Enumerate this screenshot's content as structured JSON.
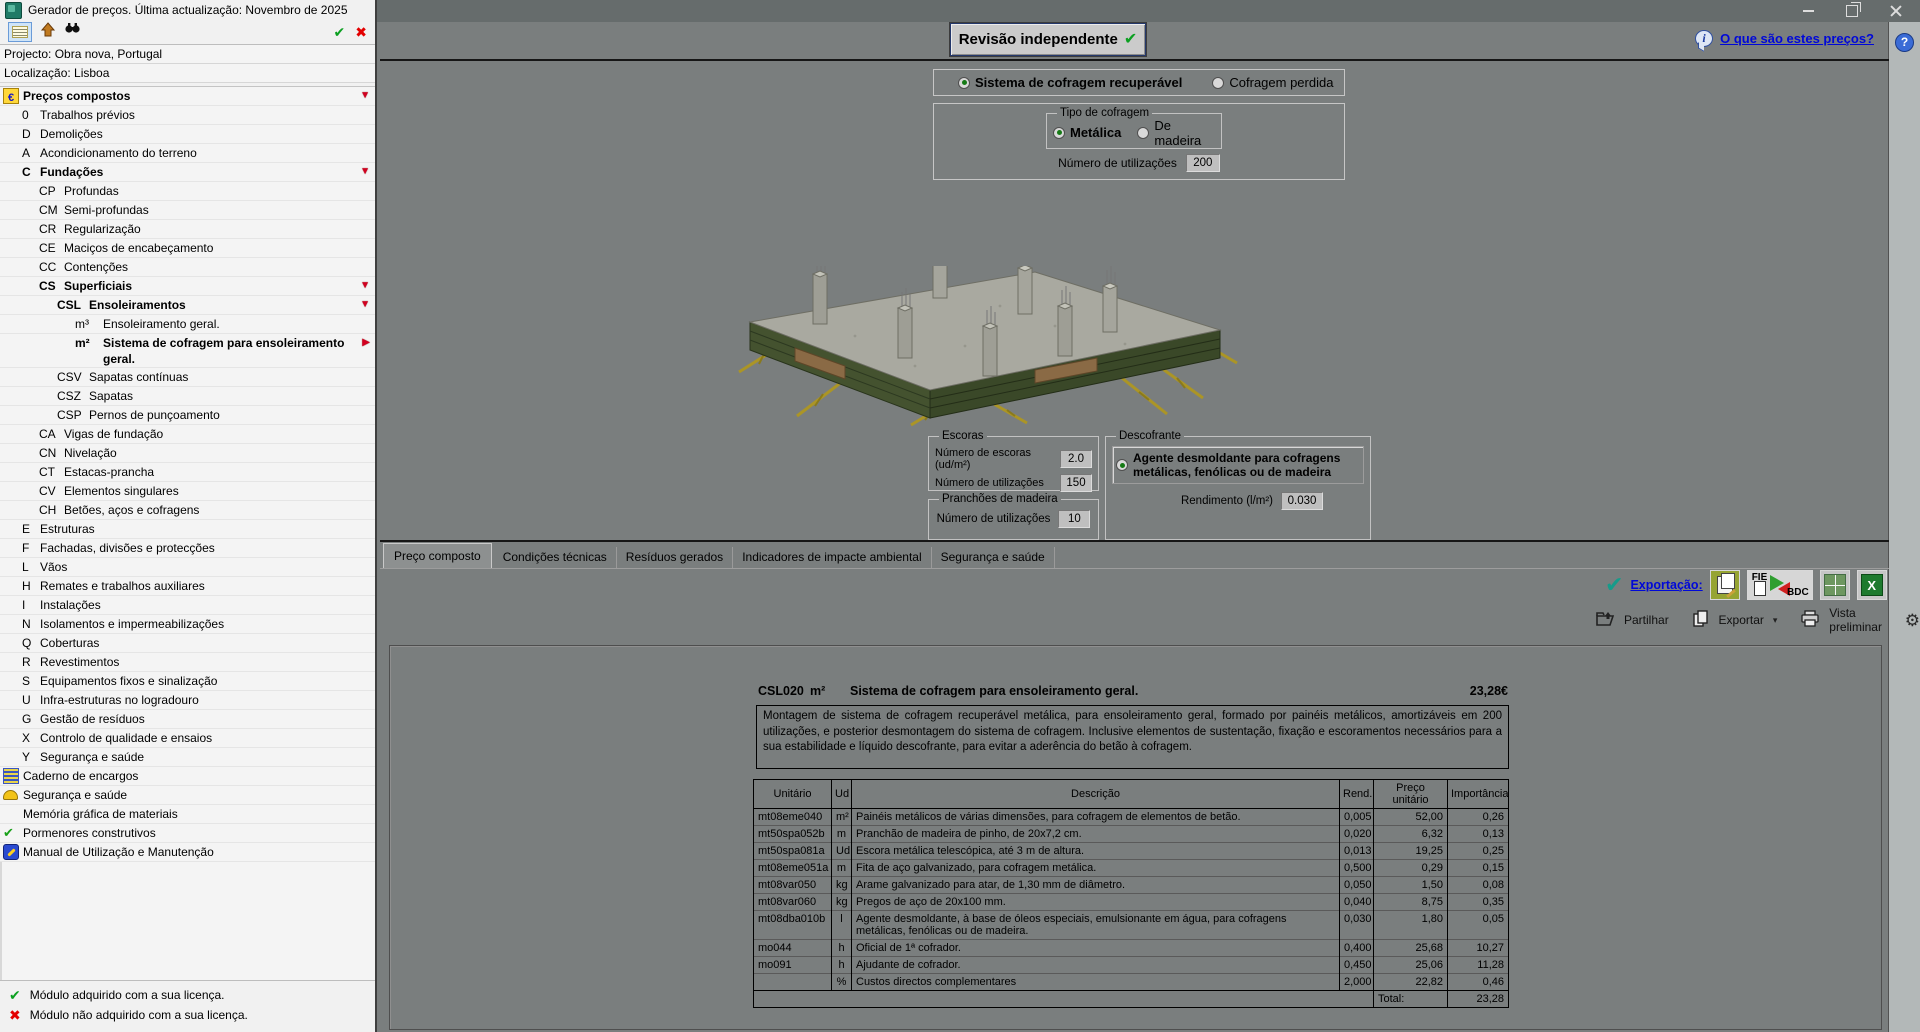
{
  "icons": {
    "check": "✔",
    "cross": "✖",
    "gear": "⚙",
    "dropdown": "▾",
    "info_i": "i",
    "help_q": "?"
  },
  "titlebar": {
    "title": "Gerador de preços. Última actualização: Novembro de 2025"
  },
  "left_panel": {
    "project": "Projecto: Obra nova, Portugal",
    "location": "Localização: Lisboa",
    "tree": [
      {
        "indent": 0,
        "icon": "euro",
        "code": "",
        "label": "Preços compostos",
        "bold": true,
        "marker": "▼"
      },
      {
        "indent": 1,
        "code": "0",
        "label": "Trabalhos prévios"
      },
      {
        "indent": 1,
        "code": "D",
        "label": "Demolições"
      },
      {
        "indent": 1,
        "code": "A",
        "label": "Acondicionamento do terreno"
      },
      {
        "indent": 1,
        "code": "C",
        "label": "Fundações",
        "bold": true,
        "marker": "▼"
      },
      {
        "indent": 2,
        "code": "CP",
        "label": "Profundas"
      },
      {
        "indent": 2,
        "code": "CM",
        "label": "Semi-profundas"
      },
      {
        "indent": 2,
        "code": "CR",
        "label": "Regularização"
      },
      {
        "indent": 2,
        "code": "CE",
        "label": "Maciços de encabeçamento"
      },
      {
        "indent": 2,
        "code": "CC",
        "label": "Contenções"
      },
      {
        "indent": 2,
        "code": "CS",
        "label": "Superficiais",
        "bold": true,
        "marker": "▼"
      },
      {
        "indent": 3,
        "code": "CSL",
        "label": "Ensoleiramentos",
        "bold": true,
        "marker": "▼"
      },
      {
        "indent": 4,
        "code": "m³",
        "label": "Ensoleiramento geral."
      },
      {
        "indent": 4,
        "code": "m²",
        "label": "Sistema de cofragem para ensoleiramento geral.",
        "bold": true,
        "marker": "▶",
        "selected": true
      },
      {
        "indent": 3,
        "code": "CSV",
        "label": "Sapatas contínuas"
      },
      {
        "indent": 3,
        "code": "CSZ",
        "label": "Sapatas"
      },
      {
        "indent": 3,
        "code": "CSP",
        "label": "Pernos de punçoamento"
      },
      {
        "indent": 2,
        "code": "CA",
        "label": "Vigas de fundação"
      },
      {
        "indent": 2,
        "code": "CN",
        "label": "Nivelação"
      },
      {
        "indent": 2,
        "code": "CT",
        "label": "Estacas-prancha"
      },
      {
        "indent": 2,
        "code": "CV",
        "label": "Elementos singulares"
      },
      {
        "indent": 2,
        "code": "CH",
        "label": "Betões, aços e cofragens"
      },
      {
        "indent": 1,
        "code": "E",
        "label": "Estruturas"
      },
      {
        "indent": 1,
        "code": "F",
        "label": "Fachadas, divisões e protecções"
      },
      {
        "indent": 1,
        "code": "L",
        "label": "Vãos"
      },
      {
        "indent": 1,
        "code": "H",
        "label": "Remates e trabalhos auxiliares"
      },
      {
        "indent": 1,
        "code": "I",
        "label": "Instalações"
      },
      {
        "indent": 1,
        "code": "N",
        "label": "Isolamentos e impermeabilizações"
      },
      {
        "indent": 1,
        "code": "Q",
        "label": "Coberturas"
      },
      {
        "indent": 1,
        "code": "R",
        "label": "Revestimentos"
      },
      {
        "indent": 1,
        "code": "S",
        "label": "Equipamentos fixos e sinalização"
      },
      {
        "indent": 1,
        "code": "U",
        "label": "Infra-estruturas no logradouro"
      },
      {
        "indent": 1,
        "code": "G",
        "label": "Gestão de resíduos"
      },
      {
        "indent": 1,
        "code": "X",
        "label": "Controlo de qualidade e ensaios"
      },
      {
        "indent": 1,
        "code": "Y",
        "label": "Segurança e saúde"
      },
      {
        "indent": 0,
        "icon": "scroll",
        "code": "",
        "label": "Caderno de encargos"
      },
      {
        "indent": 0,
        "icon": "helmet",
        "code": "",
        "label": "Segurança e saúde"
      },
      {
        "indent": 0,
        "icon": "blank",
        "code": "",
        "label": "Memória gráfica de materiais"
      },
      {
        "indent": 0,
        "icon": "gcheck",
        "code": "",
        "label": "Pormenores construtivos"
      },
      {
        "indent": 0,
        "icon": "manual",
        "code": "",
        "label": "Manual de Utilização e Manutenção"
      }
    ],
    "legend": {
      "acquired": "Módulo adquirido com a sua licença.",
      "not_acquired": "Módulo não adquirido com a sua licença."
    }
  },
  "main": {
    "review_button": "Revisão independente",
    "help_link": "O que são estes preços?",
    "form": {
      "system_options": [
        {
          "label": "Sistema de cofragem recuperável",
          "selected": true,
          "bold": true
        },
        {
          "label": "Cofragem perdida",
          "selected": false,
          "bold": false
        }
      ],
      "tipo": {
        "legend": "Tipo de cofragem",
        "options": [
          {
            "label": "Metálica",
            "selected": true,
            "bold": true
          },
          {
            "label": "De madeira",
            "selected": false,
            "bold": false
          }
        ]
      },
      "uses": {
        "label": "Número de utilizações",
        "value": "200"
      },
      "escoras": {
        "legend": "Escoras",
        "fields": [
          {
            "label": "Número de escoras (ud/m²)",
            "value": "2.0"
          },
          {
            "label": "Número de utilizações",
            "value": "150"
          }
        ]
      },
      "pranchoes": {
        "legend": "Pranchões de madeira",
        "fields": [
          {
            "label": "Número de utilizações",
            "value": "10"
          }
        ]
      },
      "descofrante": {
        "legend": "Descofrante",
        "option": "Agente desmoldante para cofragens metálicas, fenólicas ou de madeira",
        "rend_label": "Rendimento (l/m²)",
        "rend_value": "0.030"
      }
    },
    "tabs": [
      {
        "label": "Preço composto",
        "active": true
      },
      {
        "label": "Condições técnicas"
      },
      {
        "label": "Resíduos gerados"
      },
      {
        "label": "Indicadores de impacte ambiental"
      },
      {
        "label": "Segurança e saúde"
      }
    ],
    "export_bar": {
      "label": "Exportação:",
      "fie": "FIE",
      "bdc": "BDC",
      "xls_letter": "X",
      "partilhar": "Partilhar",
      "exportar": "Exportar",
      "vista": "Vista preliminar"
    },
    "document": {
      "code": "CSL020",
      "unit": "m²",
      "title": "Sistema de cofragem para ensoleiramento geral.",
      "price": "23,28€",
      "description": "Montagem de sistema de cofragem recuperável metálica, para ensoleiramento geral, formado por painéis metálicos, amortizáveis em 200 utilizações, e posterior desmontagem do sistema de cofragem. Inclusive elementos de sustentação, fixação e escoramentos necessários para a sua estabilidade e líquido descofrante, para evitar a aderência do betão à cofragem.",
      "table": {
        "headers": [
          "Unitário",
          "Ud",
          "Descrição",
          "Rend.",
          "Preço unitário",
          "Importância"
        ],
        "rows": [
          [
            "mt08eme040",
            "m²",
            "Painéis metálicos de várias dimensões, para cofragem de elementos de betão.",
            "0,005",
            "52,00",
            "0,26"
          ],
          [
            "mt50spa052b",
            "m",
            "Pranchão de madeira de pinho, de 20x7,2 cm.",
            "0,020",
            "6,32",
            "0,13"
          ],
          [
            "mt50spa081a",
            "Ud",
            "Escora metálica telescópica, até 3 m de altura.",
            "0,013",
            "19,25",
            "0,25"
          ],
          [
            "mt08eme051a",
            "m",
            "Fita de aço galvanizado, para cofragem metálica.",
            "0,500",
            "0,29",
            "0,15"
          ],
          [
            "mt08var050",
            "kg",
            "Arame galvanizado para atar, de 1,30 mm de diâmetro.",
            "0,050",
            "1,50",
            "0,08"
          ],
          [
            "mt08var060",
            "kg",
            "Pregos de aço de 20x100 mm.",
            "0,040",
            "8,75",
            "0,35"
          ],
          [
            "mt08dba010b",
            "l",
            "Agente desmoldante, à base de óleos especiais, emulsionante em água, para cofragens metálicas, fenólicas ou de madeira.",
            "0,030",
            "1,80",
            "0,05"
          ],
          [
            "mo044",
            "h",
            "Oficial de 1ª cofrador.",
            "0,400",
            "25,68",
            "10,27"
          ],
          [
            "mo091",
            "h",
            "Ajudante de cofrador.",
            "0,450",
            "25,06",
            "11,28"
          ],
          [
            "",
            "%",
            "Custos directos complementares",
            "2,000",
            "22,82",
            "0,46"
          ]
        ],
        "total_label": "Total:",
        "total_value": "23,28"
      }
    }
  }
}
